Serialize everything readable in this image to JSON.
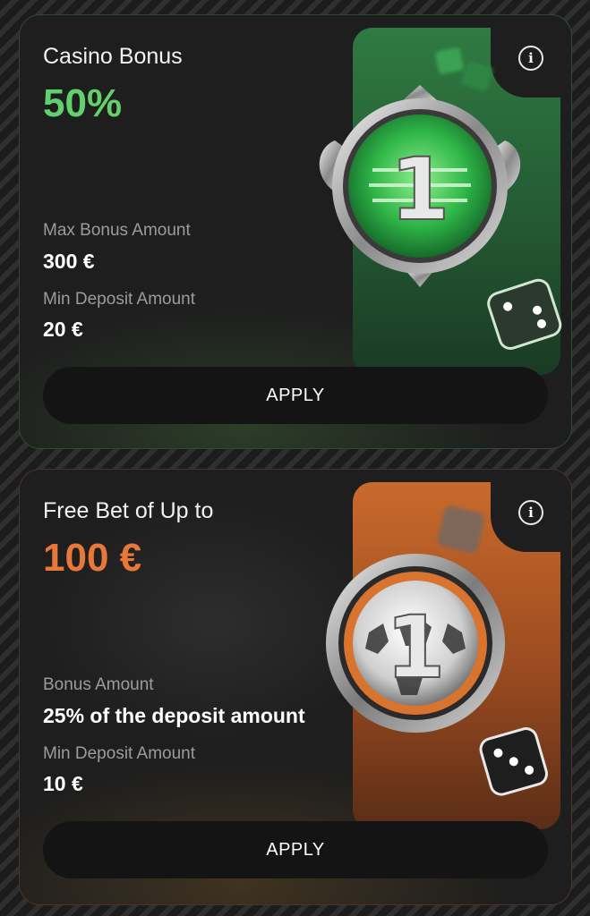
{
  "cards": [
    {
      "title": "Casino Bonus",
      "highlight": "50%",
      "field1_label": "Max Bonus Amount",
      "field1_value": "300 €",
      "field2_label": "Min Deposit Amount",
      "field2_value": "20 €",
      "apply_label": "APPLY",
      "info_label": "i",
      "badge_number": "1",
      "accent": "#62d06c"
    },
    {
      "title": "Free Bet of Up to",
      "highlight": "100 €",
      "field1_label": "Bonus Amount",
      "field1_value": "25% of the deposit amount",
      "field2_label": "Min Deposit Amount",
      "field2_value": "10 €",
      "apply_label": "APPLY",
      "info_label": "i",
      "badge_number": "1",
      "accent": "#e8773a"
    }
  ],
  "icons": [
    "info-icon",
    "casino-badge-icon",
    "football-badge-icon",
    "dice-icon"
  ]
}
